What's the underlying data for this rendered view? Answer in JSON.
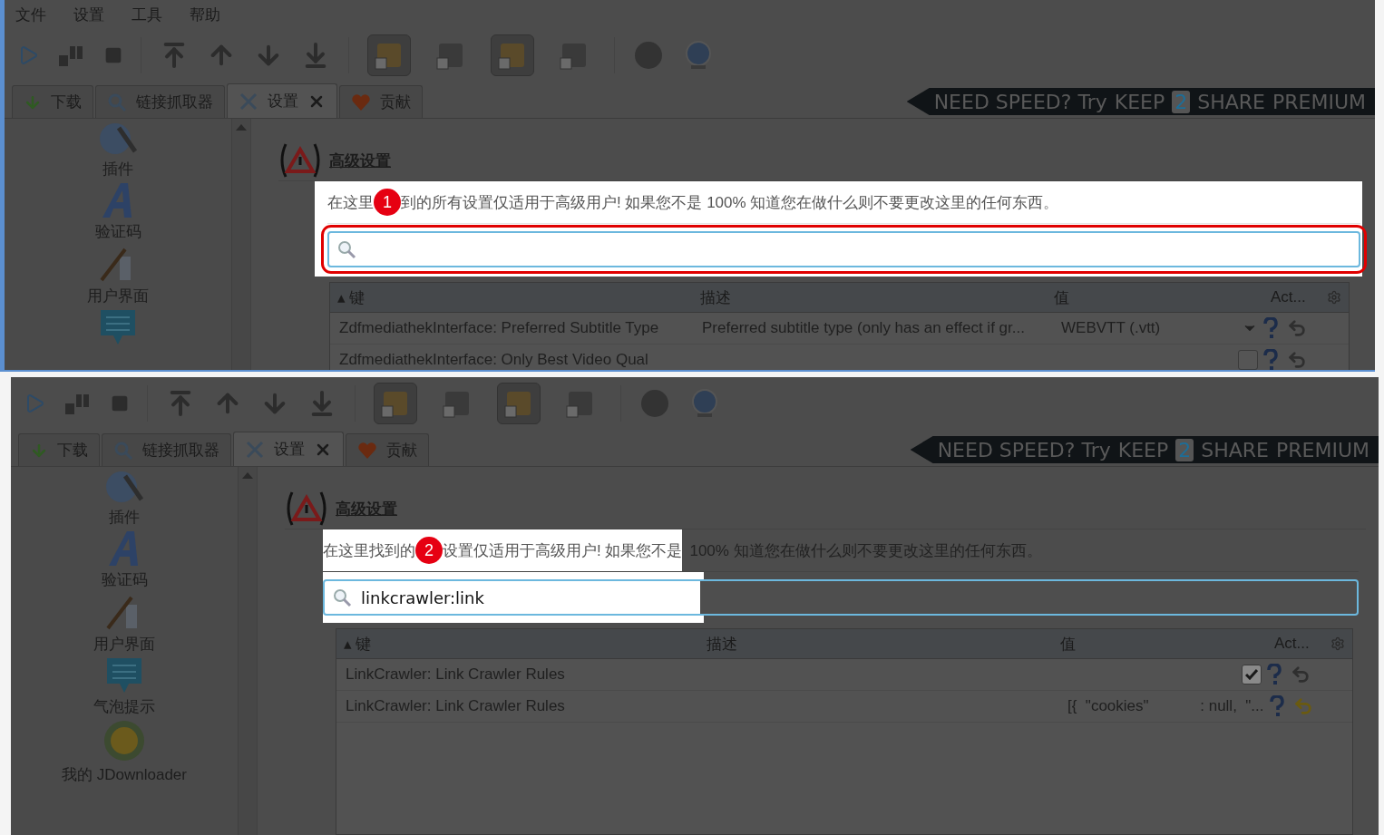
{
  "windows": [
    {
      "menu": [
        "文件",
        "设置",
        "工具",
        "帮助"
      ],
      "toggle_buttons": [
        {
          "pressed": true
        },
        {
          "pressed": false
        },
        {
          "pressed": true
        },
        {
          "pressed": false
        }
      ],
      "tabs": [
        {
          "label": "下载",
          "kind": "download",
          "selected": false
        },
        {
          "label": "链接抓取器",
          "kind": "crawler",
          "selected": false
        },
        {
          "label": "设置",
          "kind": "settings",
          "selected": true,
          "closable": true
        },
        {
          "label": "贡献",
          "kind": "heart",
          "selected": false
        }
      ],
      "banner": {
        "lead": "NEED SPEED? Try",
        "brand_1": "KEEP",
        "brand_number": "2",
        "brand_2": "SHARE",
        "tail": "PREMIUM"
      },
      "sidebar": [
        {
          "kind": "plugin",
          "label": "插件"
        },
        {
          "kind": "captcha",
          "label": "验证码"
        },
        {
          "kind": "ui",
          "label": "用户界面"
        },
        {
          "kind": "bubble"
        }
      ],
      "section_title": "高级设置",
      "partial_highlight": false,
      "step": "1",
      "description_before": "在这里",
      "description_after": "到的所有设置仅适用于高级用户! 如果您不是 100% 知道您在做什么则不要更改这里的任何东西。",
      "table": {
        "sort_marker": "▴",
        "columns": [
          "键",
          "描述",
          "值",
          "Act..."
        ],
        "rows": [
          {
            "key": "ZdfmediathekInterface: Preferred Subtitle Type",
            "description": "Preferred subtitle type (only has an effect if gr...",
            "kind": "dropdown",
            "value": "WEBVTT (.vtt)",
            "modified": false
          },
          {
            "key": "ZdfmediathekInterface: Only Best Video Qual",
            "kind": "checkbox",
            "checked": false,
            "modified": false
          }
        ]
      }
    },
    {
      "toggle_buttons": [
        {
          "pressed": true
        },
        {
          "pressed": false
        },
        {
          "pressed": true
        },
        {
          "pressed": false
        }
      ],
      "tabs": [
        {
          "label": "下载",
          "kind": "download",
          "selected": false
        },
        {
          "label": "链接抓取器",
          "kind": "crawler",
          "selected": false
        },
        {
          "label": "设置",
          "kind": "settings",
          "selected": true,
          "closable": true
        },
        {
          "label": "贡献",
          "kind": "heart",
          "selected": false
        }
      ],
      "banner": {
        "lead": "NEED SPEED? Try",
        "brand_1": "KEEP",
        "brand_number": "2",
        "brand_2": "SHARE",
        "tail": "PREMIUM"
      },
      "sidebar": [
        {
          "kind": "plugin",
          "label": "插件"
        },
        {
          "kind": "captcha",
          "label": "验证码"
        },
        {
          "kind": "ui",
          "label": "用户界面"
        },
        {
          "kind": "bubble",
          "label": "气泡提示"
        },
        {
          "kind": "my",
          "label": "我的 JDownloader"
        }
      ],
      "section_title": "高级设置",
      "partial_highlight": true,
      "step": "2",
      "description_before": "在这里找到的",
      "description_after": "设置仅适用于高级用户! 如果您不是",
      "description_dim": "100% 知道您在做什么则不要更改这里的任何东西。",
      "search": {
        "value": "linkcrawler:link"
      },
      "table": {
        "sort_marker": "▴",
        "columns": [
          "键",
          "描述",
          "值",
          "Act..."
        ],
        "rows": [
          {
            "key": "LinkCrawler: Link Crawler Rules",
            "kind": "checkbox",
            "checked": true,
            "modified": false
          },
          {
            "key": "LinkCrawler: Link Crawler Rules",
            "kind": "text",
            "value": "[{  \"cookies\"            : null,  \"...",
            "modified": true
          }
        ]
      }
    }
  ]
}
